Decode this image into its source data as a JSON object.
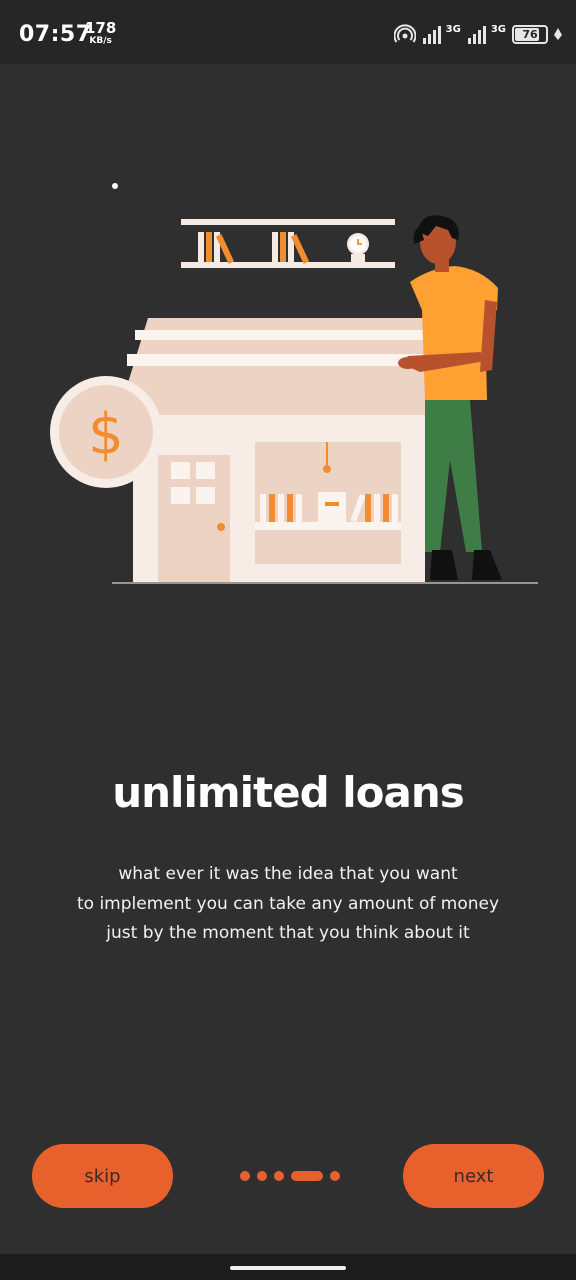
{
  "status_bar": {
    "time": "07:57",
    "net_speed_value": "178",
    "net_speed_unit": "KB/s",
    "network_1": "3G",
    "network_2": "3G",
    "battery_level": "76",
    "icons": [
      "hotspot-icon",
      "signal-icon",
      "signal-icon",
      "battery-icon",
      "charging-icon"
    ]
  },
  "onboarding": {
    "title": "unlimited loans",
    "description_lines": [
      "what ever it was the idea that you want",
      "to implement you can take any amount of money",
      "just by the moment that you think about it"
    ],
    "illustration_symbol": "$",
    "page_total": 5,
    "current_page": 4
  },
  "buttons": {
    "skip_label": "skip",
    "next_label": "next"
  },
  "colors": {
    "background": "#2f2f2f",
    "accent": "#e8612c",
    "illustration_orange": "#f28c2e",
    "shirt": "#ffa033",
    "pants": "#3e7d46",
    "cream": "#f5ebe4",
    "tan": "#e8cdbc"
  }
}
